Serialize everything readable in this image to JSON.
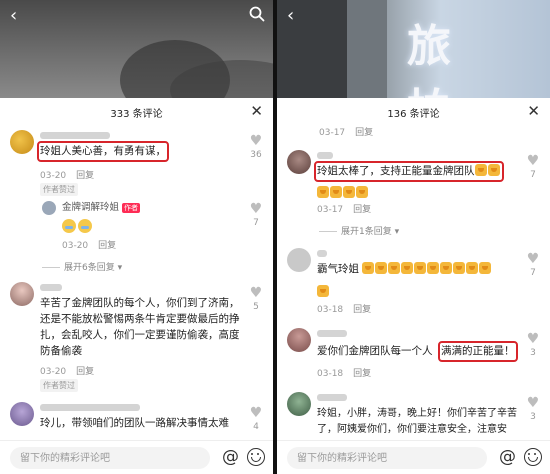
{
  "left": {
    "title": "333 条评论",
    "close": "✕",
    "back": "‹",
    "comments": [
      {
        "text": "玲姐人美心善，有勇有谋，",
        "date": "03-20",
        "reply": "回复",
        "liked": "作者赞过",
        "likes": "36"
      },
      {
        "name": "金牌调解玲姐",
        "author_tag": "作者",
        "date": "03-20",
        "reply": "回复",
        "likes": "7"
      },
      {
        "expand": "展开6条回复"
      },
      {
        "lines": [
          "辛苦了金牌团队的每个人，你们到了济南，",
          "还是不能放松警惕两条牛肯定要做最后的挣",
          "扎，会乱咬人，你们一定要谨防偷袭，高度",
          "防备偷袭"
        ],
        "date": "03-20",
        "reply": "回复",
        "liked": "作者赞过",
        "likes": "5"
      },
      {
        "text": "玲儿，带领咱们的团队一路解决事情太难",
        "likes": "4"
      }
    ],
    "input_placeholder": "留下你的精彩评论吧"
  },
  "right": {
    "title": "136 条评论",
    "close": "✕",
    "back": "‹",
    "sign_text": "旅 拍",
    "first_meta": {
      "date": "03-17",
      "reply": "回复"
    },
    "comments": [
      {
        "text": "玲姐太棒了，支持正能量金牌团队",
        "date": "03-17",
        "reply": "回复",
        "likes": "7"
      },
      {
        "expand": "展开1条回复"
      },
      {
        "text": "霸气玲姐",
        "date": "03-18",
        "reply": "回复",
        "likes": "7"
      },
      {
        "text": "爱你们金牌团队每一个人",
        "highlight": "满满的正能量！",
        "date": "03-18",
        "reply": "回复",
        "likes": "3"
      },
      {
        "lines": [
          "玲姐，小胖，涛哥，晚上好！你们辛苦了辛苦",
          "了，阿姨爱你们，你们要注意安全，注意安"
        ],
        "likes": "3"
      }
    ],
    "input_placeholder": "留下你的精彩评论吧"
  }
}
